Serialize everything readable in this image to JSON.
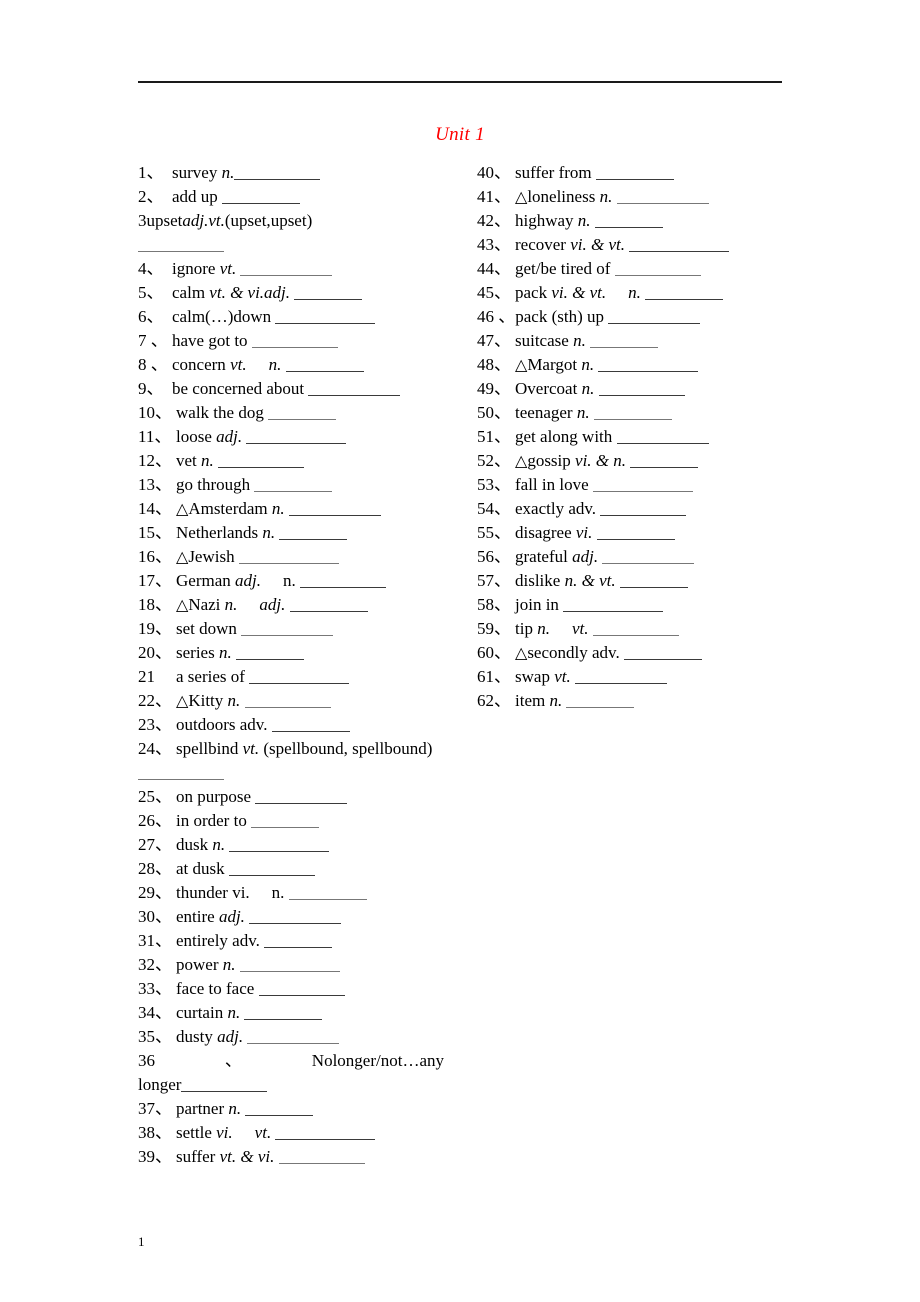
{
  "document": {
    "title": "Unit 1",
    "title_color": "#ff0000",
    "page_number": "1",
    "enumeration_comma": "、",
    "triangle_marker": "△"
  },
  "left_column": [
    {
      "num": "1",
      "comma": "、",
      "text": "survey",
      "pos": "n.",
      "blank": true
    },
    {
      "num": "2",
      "comma": "、",
      "text": "add up",
      "pos": "",
      "blank": true
    },
    {
      "num": "3",
      "comma": "",
      "text": "upset",
      "pos": "adj.vt.",
      "extra": "(upset,",
      "extra2": "upset)",
      "wrap_blank": true
    },
    {
      "num": "4",
      "comma": "、",
      "text": "ignore",
      "pos": "vt.",
      "blank": true
    },
    {
      "num": "5",
      "comma": "、",
      "text": "calm",
      "pos": "vt. & vi.adj.",
      "blank": true
    },
    {
      "num": "6",
      "comma": "、",
      "text": "calm(…)down",
      "pos": "",
      "blank": true
    },
    {
      "num": "7",
      "comma": " 、",
      "text": "have got to",
      "pos": "",
      "blank": true
    },
    {
      "num": "8",
      "comma": " 、",
      "text": "concern",
      "pos": "vt.",
      "pos2": "n.",
      "blank": true
    },
    {
      "num": "9",
      "comma": "、",
      "text": "be concerned about",
      "pos": "",
      "blank": true
    },
    {
      "num": "10",
      "comma": "、",
      "text": "walk the dog",
      "pos": "",
      "blank": true
    },
    {
      "num": "11",
      "comma": "、",
      "text": "loose",
      "pos": "adj.",
      "blank": true
    },
    {
      "num": "12",
      "comma": "、",
      "text": "vet",
      "pos": "n.",
      "blank": true
    },
    {
      "num": "13",
      "comma": "、",
      "text": "go through",
      "pos": "",
      "blank": true
    },
    {
      "num": "14",
      "comma": "、",
      "tri": true,
      "text": "Amsterdam",
      "pos": "n.",
      "blank": true
    },
    {
      "num": "15",
      "comma": "、",
      "text": "Netherlands",
      "pos": "n.",
      "blank": true
    },
    {
      "num": "16",
      "comma": "、",
      "tri": true,
      "text": "Jewish",
      "pos": "",
      "blank": true
    },
    {
      "num": "17",
      "comma": "、",
      "text": "German",
      "pos": "adj.",
      "pos2": "n.",
      "blank": true
    },
    {
      "num": "18",
      "comma": "、",
      "tri": true,
      "text": "Nazi",
      "pos": "n.",
      "pos2": "adj.",
      "blank": true
    },
    {
      "num": "19",
      "comma": "、",
      "text": "set down",
      "pos": "",
      "blank": true
    },
    {
      "num": "20",
      "comma": "、",
      "text": "series",
      "pos": "n.",
      "blank": true
    },
    {
      "num": "21",
      "comma": "",
      "text": "a series of",
      "pos": "",
      "blank": true
    },
    {
      "num": "22",
      "comma": "、",
      "tri": true,
      "text": "Kitty",
      "pos": "n.",
      "blank": true
    },
    {
      "num": "23",
      "comma": "、",
      "text": "outdoors",
      "pos": "adv.",
      "blank": true
    },
    {
      "num": "24",
      "comma": "、",
      "text": "spellbind",
      "pos": "vt.",
      "extra": "(spellbound, spellbound)",
      "wrap_blank": true
    },
    {
      "num": "25",
      "comma": "、",
      "text": "on purpose",
      "pos": "",
      "blank": true
    },
    {
      "num": "26",
      "comma": "、",
      "text": "in order to",
      "pos": "",
      "blank": true
    },
    {
      "num": "27",
      "comma": "、",
      "text": "dusk",
      "pos": "n.",
      "blank": true
    },
    {
      "num": "28",
      "comma": "、",
      "text": "at dusk",
      "pos": "",
      "blank": true
    },
    {
      "num": "29",
      "comma": "、",
      "text": "thunder",
      "pos": "vi.",
      "pos2": "n.",
      "blank": true
    },
    {
      "num": "30",
      "comma": "、",
      "text": "entire",
      "pos": "adj.",
      "blank": true
    },
    {
      "num": "31",
      "comma": "、",
      "text": "entirely",
      "pos": "adv.",
      "blank": true
    },
    {
      "num": "32",
      "comma": "、",
      "text": "power",
      "pos": "n.",
      "blank": true
    },
    {
      "num": "33",
      "comma": "、",
      "text": "face to face",
      "pos": "",
      "blank": true
    },
    {
      "num": "34",
      "comma": "、",
      "text": "curtain",
      "pos": "n.",
      "blank": true
    },
    {
      "num": "35",
      "comma": "、",
      "text": "dusty",
      "pos": "adj.",
      "blank": true
    },
    {
      "num": "36",
      "comma": "、",
      "text": "No",
      "extra": "longer/not…any",
      "cont_text": "longer",
      "wrap_blank_inline": true
    },
    {
      "num": "37",
      "comma": "、",
      "text": "partner",
      "pos": "n.",
      "blank": true
    },
    {
      "num": "38",
      "comma": "、",
      "text": "settle",
      "pos": "vi.",
      "pos2": "vt.",
      "blank": true
    },
    {
      "num": "39",
      "comma": "、",
      "text": "suffer",
      "pos": "vt. & vi.",
      "blank": true
    }
  ],
  "right_column": [
    {
      "num": "40",
      "comma": "、",
      "text": "suffer from",
      "pos": "",
      "blank": true
    },
    {
      "num": "41",
      "comma": "、",
      "tri": true,
      "text": "loneliness",
      "pos": "n.",
      "blank": true
    },
    {
      "num": "42",
      "comma": "、",
      "text": "highway",
      "pos": "n.",
      "blank": true
    },
    {
      "num": "43",
      "comma": "、",
      "text": "recover",
      "pos": "vi. & vt.",
      "blank": true
    },
    {
      "num": "44",
      "comma": "、",
      "text": "get/be tired of",
      "pos": "",
      "blank": true
    },
    {
      "num": "45",
      "comma": "、",
      "text": "pack",
      "pos": "vi. & vt.",
      "pos2": "n.",
      "blank": true
    },
    {
      "num": "46",
      "comma": " 、",
      "text": "pack (sth) up",
      "pos": "",
      "blank": true
    },
    {
      "num": "47",
      "comma": "、",
      "text": "suitcase",
      "pos": "n.",
      "blank": true
    },
    {
      "num": "48",
      "comma": "、",
      "tri": true,
      "text": "Margot",
      "pos": "n.",
      "blank": true
    },
    {
      "num": "49",
      "comma": "、",
      "text": "Overcoat",
      "pos": "n.",
      "blank": true
    },
    {
      "num": "50",
      "comma": "、",
      "text": "teenager",
      "pos": "n.",
      "blank": true
    },
    {
      "num": "51",
      "comma": "、",
      "text": "get along with",
      "pos": "",
      "blank": true
    },
    {
      "num": "52",
      "comma": "、",
      "tri": true,
      "text": "gossip",
      "pos": "vi. & n.",
      "blank": true
    },
    {
      "num": "53",
      "comma": "、",
      "text": "fall in love",
      "pos": "",
      "blank": true
    },
    {
      "num": "54",
      "comma": "、",
      "text": "exactly",
      "pos": "adv.",
      "blank": true
    },
    {
      "num": "55",
      "comma": "、",
      "text": "disagree",
      "pos": "vi.",
      "blank": true
    },
    {
      "num": "56",
      "comma": "、",
      "text": "grateful",
      "pos": "adj.",
      "blank": true
    },
    {
      "num": "57",
      "comma": "、",
      "text": "dislike",
      "pos": "n. & vt.",
      "blank": true
    },
    {
      "num": "58",
      "comma": "、",
      "text": "join in",
      "pos": "",
      "blank": true
    },
    {
      "num": "59",
      "comma": "、",
      "text": "tip",
      "pos": "n.",
      "pos2": "vt.",
      "blank": true
    },
    {
      "num": "60",
      "comma": "、",
      "tri": true,
      "text": "secondly",
      "pos": "adv.",
      "blank": true
    },
    {
      "num": "61",
      "comma": "、",
      "text": "swap",
      "pos": "vt.",
      "blank": true
    },
    {
      "num": "62",
      "comma": "、",
      "text": "item",
      "pos": "n.",
      "blank": true
    }
  ]
}
